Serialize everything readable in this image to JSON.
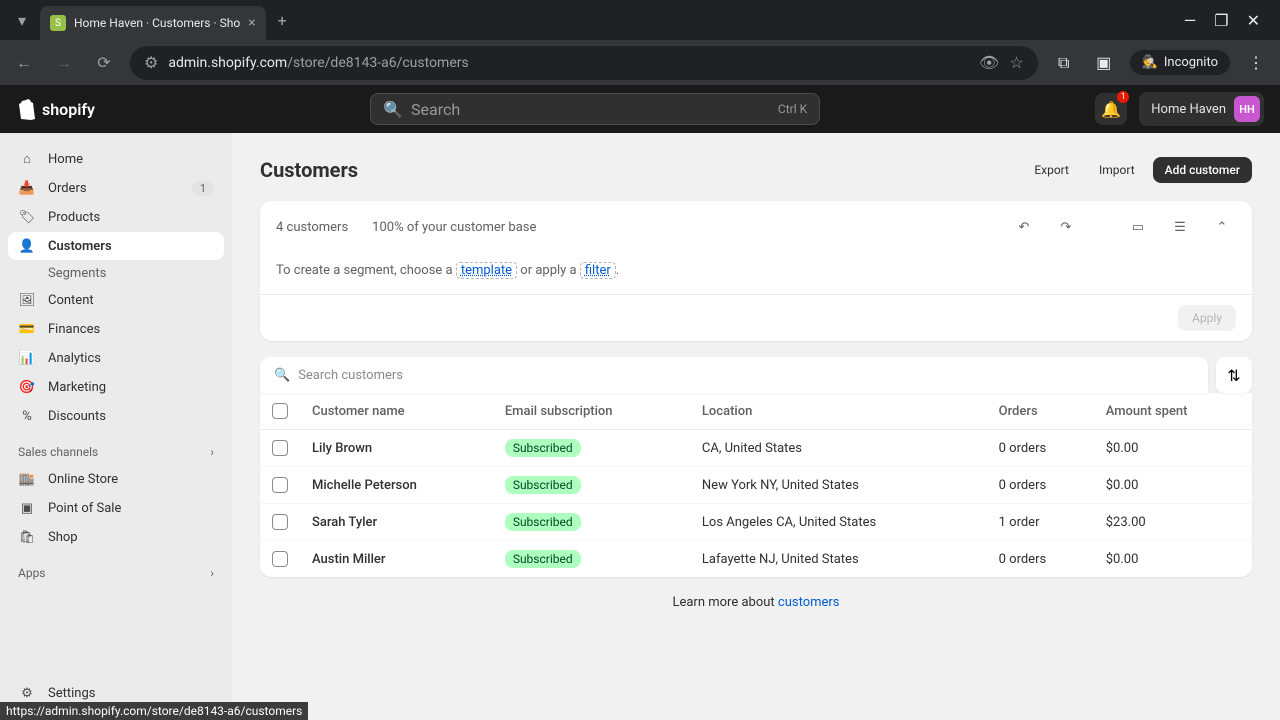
{
  "browser": {
    "tab_title": "Home Haven · Customers · Sho",
    "url_host": "admin.shopify.com",
    "url_path": "/store/de8143-a6/customers",
    "incognito_label": "Incognito",
    "status_url": "https://admin.shopify.com/store/de8143-a6/customers"
  },
  "header": {
    "logo_text": "shopify",
    "search_placeholder": "Search",
    "search_kbd": "Ctrl K",
    "bell_count": "1",
    "store_name": "Home Haven",
    "store_initials": "HH"
  },
  "sidebar": {
    "items": [
      {
        "label": "Home"
      },
      {
        "label": "Orders",
        "badge": "1"
      },
      {
        "label": "Products"
      },
      {
        "label": "Customers",
        "active": true
      },
      {
        "label": "Content"
      },
      {
        "label": "Finances"
      },
      {
        "label": "Analytics"
      },
      {
        "label": "Marketing"
      },
      {
        "label": "Discounts"
      }
    ],
    "customers_sub": "Segments",
    "section_sales": "Sales channels",
    "sales_items": [
      "Online Store",
      "Point of Sale",
      "Shop"
    ],
    "section_apps": "Apps",
    "settings": "Settings"
  },
  "page": {
    "title": "Customers",
    "export": "Export",
    "import": "Import",
    "add": "Add customer"
  },
  "segment": {
    "count": "4 customers",
    "percent": "100% of your customer base",
    "editor_pre": "To create a segment, choose a ",
    "template": "template",
    "mid": " or apply a ",
    "filter": "filter",
    "post": ".",
    "apply": "Apply"
  },
  "table": {
    "search_placeholder": "Search customers",
    "headers": {
      "name": "Customer name",
      "email": "Email subscription",
      "location": "Location",
      "orders": "Orders",
      "amount": "Amount spent"
    },
    "rows": [
      {
        "name": "Lily Brown",
        "email": "Subscribed",
        "location": "CA, United States",
        "orders": "0 orders",
        "amount": "$0.00"
      },
      {
        "name": "Michelle Peterson",
        "email": "Subscribed",
        "location": "New York NY, United States",
        "orders": "0 orders",
        "amount": "$0.00"
      },
      {
        "name": "Sarah Tyler",
        "email": "Subscribed",
        "location": "Los Angeles CA, United States",
        "orders": "1 order",
        "amount": "$23.00"
      },
      {
        "name": "Austin Miller",
        "email": "Subscribed",
        "location": "Lafayette NJ, United States",
        "orders": "0 orders",
        "amount": "$0.00"
      }
    ]
  },
  "footer": {
    "learn_pre": "Learn more about ",
    "learn_link": "customers"
  }
}
